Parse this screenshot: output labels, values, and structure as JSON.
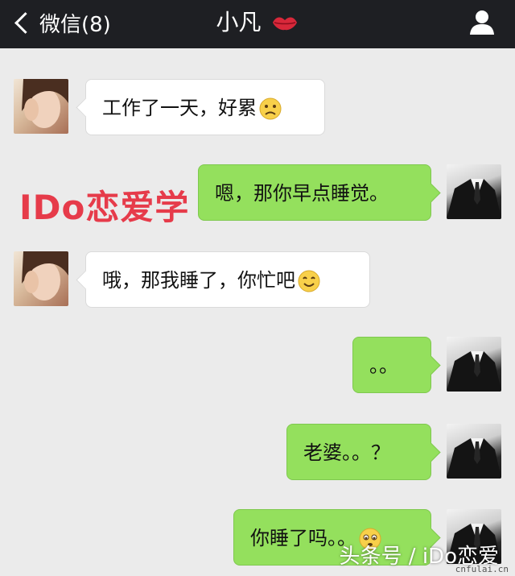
{
  "header": {
    "back_label": "微信(8)",
    "title": "小凡",
    "title_icon": "kiss-lips-icon",
    "profile_icon": "person-icon"
  },
  "brand_watermark": "IDo恋爱学",
  "messages": [
    {
      "from": "her",
      "text": "工作了一天，好累",
      "emoji": "frown-emoji"
    },
    {
      "from": "me",
      "text": "嗯，那你早点睡觉。"
    },
    {
      "from": "her",
      "text": "哦，那我睡了，你忙吧",
      "emoji": "smile-emoji"
    },
    {
      "from": "me",
      "text": "。。"
    },
    {
      "from": "me",
      "text": "老婆。。？"
    },
    {
      "from": "me",
      "text": "你睡了吗。。",
      "emoji": "pleading-emoji"
    }
  ],
  "footer_watermark": "头条号 / iDo恋爱",
  "site_watermark": "cnfulai.cn",
  "colors": {
    "topbar": "#1e1f23",
    "background": "#ebebeb",
    "outgoing_bubble": "#94e05d",
    "incoming_bubble": "#ffffff",
    "brand_red": "#e63b4a"
  }
}
